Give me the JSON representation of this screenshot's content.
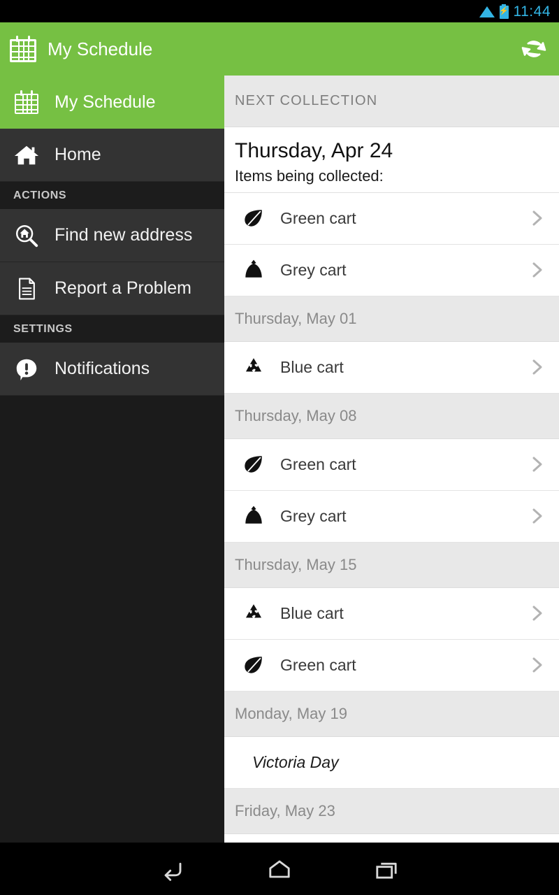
{
  "statusbar": {
    "clock": "11:44",
    "icons": [
      "wifi-icon",
      "battery-charging-icon"
    ]
  },
  "actionbar": {
    "icon": "calendar-icon",
    "title": "My Schedule",
    "refresh_icon": "refresh-icon",
    "background_color": "#76c043"
  },
  "sidebar": {
    "items": [
      {
        "label": "My Schedule",
        "icon": "calendar-icon",
        "active": true
      },
      {
        "label": "Home",
        "icon": "home-icon",
        "active": false
      }
    ],
    "sections": [
      {
        "title": "ACTIONS",
        "items": [
          {
            "label": "Find new address",
            "icon": "search-home-icon"
          },
          {
            "label": "Report a Problem",
            "icon": "document-icon"
          }
        ]
      },
      {
        "title": "SETTINGS",
        "items": [
          {
            "label": "Notifications",
            "icon": "alert-bubble-icon"
          }
        ]
      }
    ]
  },
  "list": {
    "next_header": "NEXT COLLECTION",
    "next_date": "Thursday, Apr 24",
    "next_subtitle": "Items being collected:",
    "next_items": [
      {
        "label": "Green cart",
        "icon": "leaf-icon",
        "chevron": true
      },
      {
        "label": "Grey cart",
        "icon": "garbage-bag-icon",
        "chevron": true
      }
    ],
    "groups": [
      {
        "date": "Thursday, May 01",
        "items": [
          {
            "label": "Blue cart",
            "icon": "recycle-icon",
            "chevron": true
          }
        ]
      },
      {
        "date": "Thursday, May 08",
        "items": [
          {
            "label": "Green cart",
            "icon": "leaf-icon",
            "chevron": true
          },
          {
            "label": "Grey cart",
            "icon": "garbage-bag-icon",
            "chevron": true
          }
        ]
      },
      {
        "date": "Thursday, May 15",
        "items": [
          {
            "label": "Blue cart",
            "icon": "recycle-icon",
            "chevron": true
          },
          {
            "label": "Green cart",
            "icon": "leaf-icon",
            "chevron": true
          }
        ]
      },
      {
        "date": "Monday, May 19",
        "items": [
          {
            "label": "Victoria Day",
            "icon": "none",
            "chevron": false,
            "holiday": true
          }
        ]
      },
      {
        "date": "Friday, May 23",
        "items": [
          {
            "label": "",
            "icon": "leaf-icon",
            "chevron": true,
            "clipped": true
          }
        ]
      }
    ]
  },
  "navbar": {
    "buttons": [
      {
        "name": "back-button",
        "icon": "back-icon"
      },
      {
        "name": "home-button",
        "icon": "home-outline-icon"
      },
      {
        "name": "recents-button",
        "icon": "recents-icon"
      }
    ]
  }
}
